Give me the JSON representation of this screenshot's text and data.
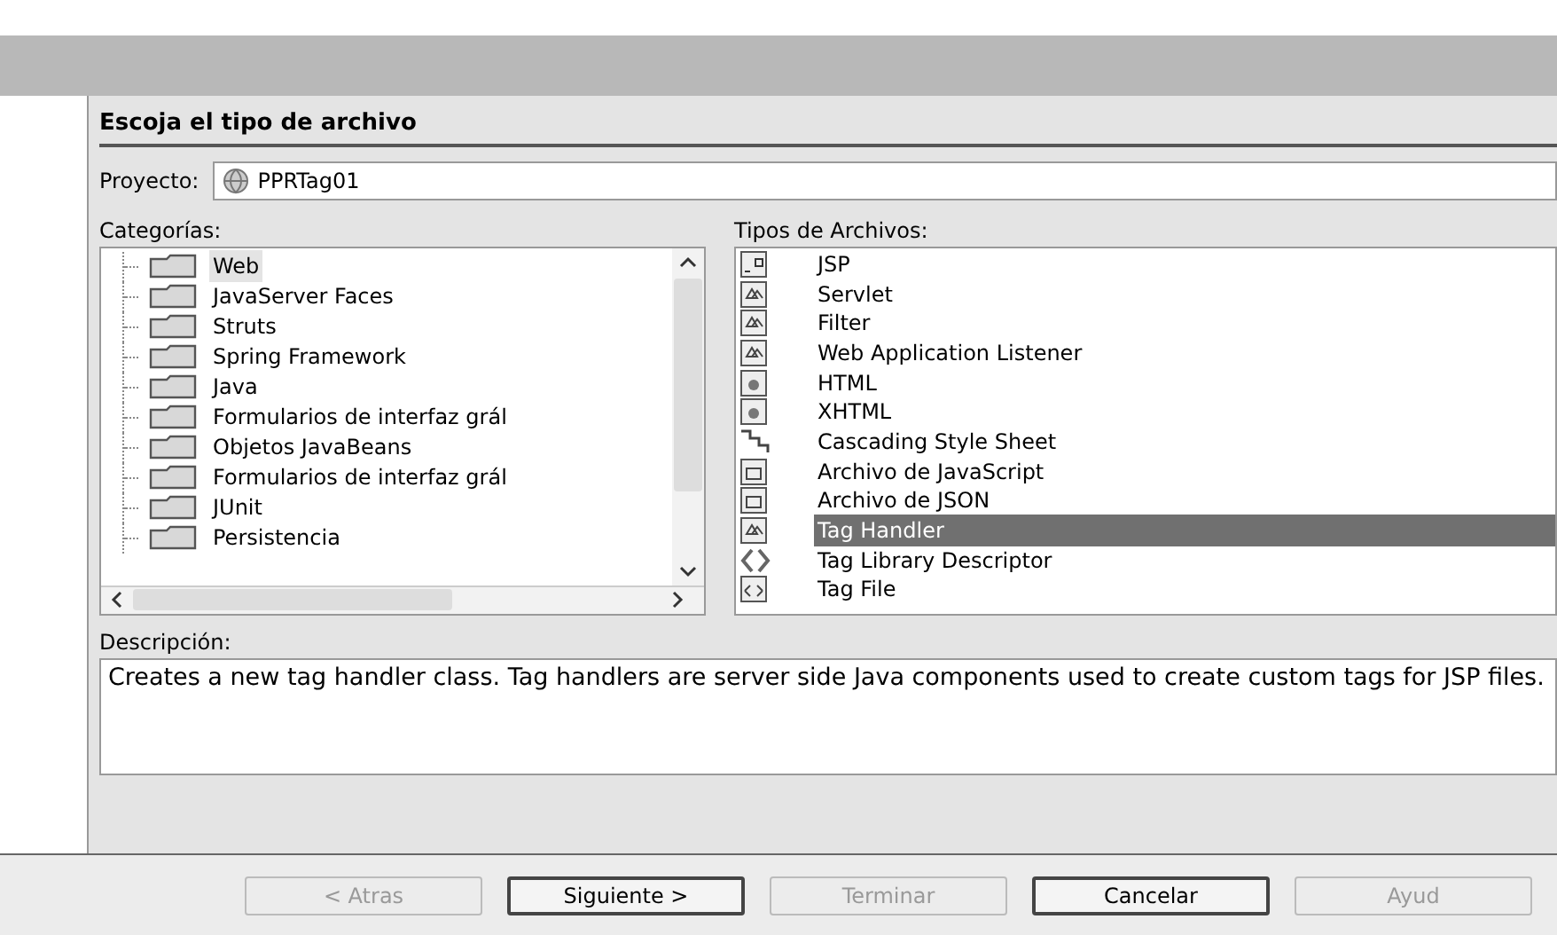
{
  "title": "Escoja el tipo de archivo",
  "project": {
    "label": "Proyecto:",
    "value": "PPRTag01"
  },
  "categories": {
    "label": "Categorías:",
    "items": [
      {
        "label": "Web",
        "selected": true
      },
      {
        "label": "JavaServer Faces",
        "selected": false
      },
      {
        "label": "Struts",
        "selected": false
      },
      {
        "label": "Spring Framework",
        "selected": false
      },
      {
        "label": "Java",
        "selected": false
      },
      {
        "label": "Formularios de interfaz grál",
        "selected": false
      },
      {
        "label": "Objetos JavaBeans",
        "selected": false
      },
      {
        "label": "Formularios de interfaz grál",
        "selected": false
      },
      {
        "label": "JUnit",
        "selected": false
      },
      {
        "label": "Persistencia",
        "selected": false
      }
    ]
  },
  "file_types": {
    "label": "Tipos de Archivos:",
    "items": [
      {
        "label": "JSP",
        "kind": "jsp",
        "selected": false
      },
      {
        "label": "Servlet",
        "kind": "class",
        "selected": false
      },
      {
        "label": "Filter",
        "kind": "class",
        "selected": false
      },
      {
        "label": "Web Application Listener",
        "kind": "class",
        "selected": false
      },
      {
        "label": "HTML",
        "kind": "html",
        "selected": false
      },
      {
        "label": "XHTML",
        "kind": "html",
        "selected": false
      },
      {
        "label": "Cascading Style Sheet",
        "kind": "css",
        "selected": false
      },
      {
        "label": "Archivo de JavaScript",
        "kind": "js",
        "selected": false
      },
      {
        "label": "Archivo de JSON",
        "kind": "js",
        "selected": false
      },
      {
        "label": "Tag Handler",
        "kind": "class",
        "selected": true
      },
      {
        "label": "Tag Library Descriptor",
        "kind": "tld",
        "selected": false
      },
      {
        "label": "Tag File",
        "kind": "tag",
        "selected": false
      }
    ]
  },
  "description": {
    "label": "Descripción:",
    "text": "Creates a new tag handler class. Tag handlers are server side Java components used to create custom tags for JSP files."
  },
  "buttons": [
    {
      "label": "< Atras",
      "disabled": true
    },
    {
      "label": "Siguiente >",
      "disabled": false
    },
    {
      "label": "Terminar",
      "disabled": true
    },
    {
      "label": "Cancelar",
      "disabled": false
    },
    {
      "label": "Ayud",
      "disabled": true
    }
  ]
}
